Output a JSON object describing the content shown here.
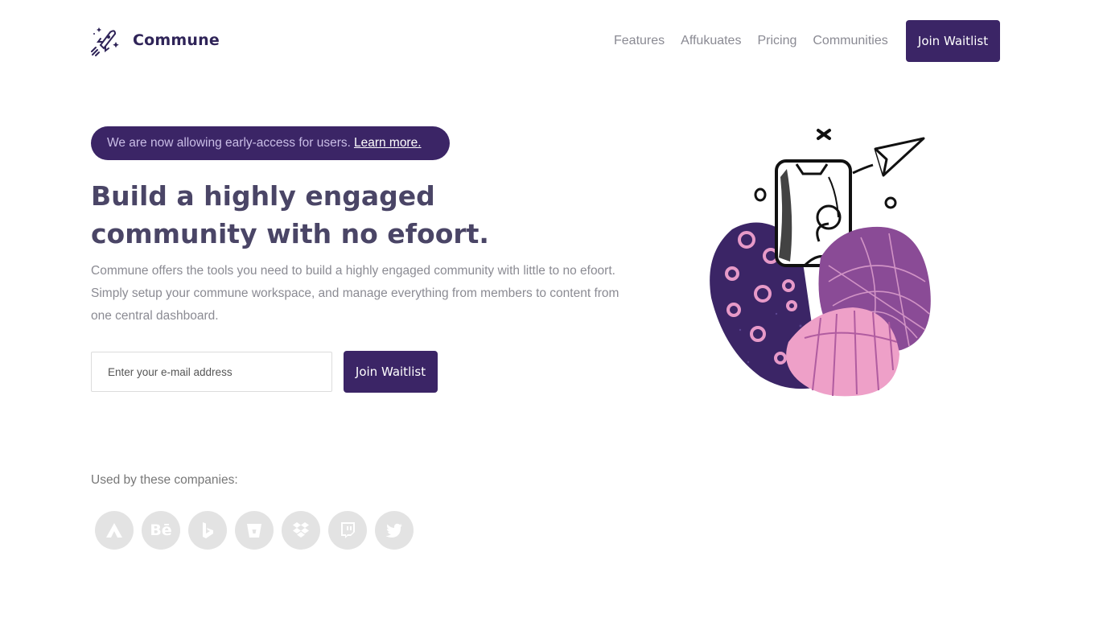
{
  "brand": {
    "name": "Commune",
    "logo_icon": "rocket-icon"
  },
  "nav": {
    "items": [
      "Features",
      "Affukuates",
      "Pricing",
      "Communities"
    ],
    "cta": "Join Waitlist"
  },
  "hero": {
    "announcement": "We are now allowing early-access for users.",
    "announcement_link": "Learn more.",
    "headline": "Build a highly engaged community with no efoort.",
    "description": "Commune offers the tools you need to build a highly engaged community with little to no efoort. Simply setup your commune workspace, and manage everything from members to content from one central dashboard.",
    "email_placeholder": "Enter your e-mail address",
    "cta": "Join Waitlist"
  },
  "companies": {
    "label": "Used by these companies:",
    "logos": [
      "airtable-icon",
      "behance-icon",
      "bing-icon",
      "bitbucket-icon",
      "dropbox-icon",
      "twitch-icon",
      "twitter-icon"
    ],
    "behance_text": "Bē"
  },
  "colors": {
    "accent": "#3b2566",
    "headline": "#4a4566",
    "muted": "#8b8b93",
    "logo_bg": "#e3e3e3"
  }
}
